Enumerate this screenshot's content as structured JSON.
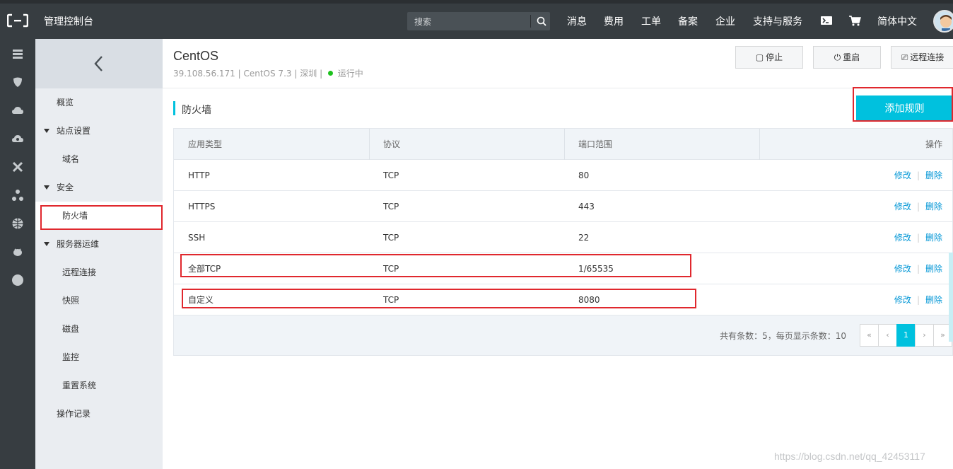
{
  "topbar": {
    "title": "管理控制台",
    "search_placeholder": "搜索",
    "nav": [
      "消息",
      "费用",
      "工单",
      "备案",
      "企业",
      "支持与服务"
    ],
    "language": "简体中文"
  },
  "sidebar": {
    "items": [
      {
        "label": "概览"
      },
      {
        "label": "站点设置"
      },
      {
        "label": "域名"
      },
      {
        "label": "安全"
      },
      {
        "label": "防火墙"
      },
      {
        "label": "服务器运维"
      },
      {
        "label": "远程连接"
      },
      {
        "label": "快照"
      },
      {
        "label": "磁盘"
      },
      {
        "label": "监控"
      },
      {
        "label": "重置系统"
      },
      {
        "label": "操作记录"
      }
    ]
  },
  "instance": {
    "name": "CentOS",
    "ip": "39.108.56.171",
    "os": "CentOS 7.3",
    "region": "深圳",
    "status": "运行中",
    "status_color": "#1dc11d"
  },
  "actions": {
    "stop": "停止",
    "restart": "重启",
    "remote": "远程连接"
  },
  "firewall": {
    "title": "防火墙",
    "add_label": "添加规则",
    "columns": [
      "应用类型",
      "协议",
      "端口范围",
      "操作"
    ],
    "rows": [
      {
        "app": "HTTP",
        "protocol": "TCP",
        "port": "80"
      },
      {
        "app": "HTTPS",
        "protocol": "TCP",
        "port": "443"
      },
      {
        "app": "SSH",
        "protocol": "TCP",
        "port": "22"
      },
      {
        "app": "全部TCP",
        "protocol": "TCP",
        "port": "1/65535"
      },
      {
        "app": "自定义",
        "protocol": "TCP",
        "port": "8080"
      }
    ],
    "edit_label": "修改",
    "delete_label": "删除",
    "pagination": {
      "info": "共有条数：5，每页显示条数：10",
      "first": "«",
      "prev": "‹",
      "current": "1",
      "next": "›",
      "last": "»"
    }
  },
  "watermark": "https://blog.csdn.net/qq_42453117",
  "colors": {
    "accent": "#00c1de",
    "link": "#0096d6",
    "highlight": "#e0282e",
    "topbar": "#373d41"
  }
}
